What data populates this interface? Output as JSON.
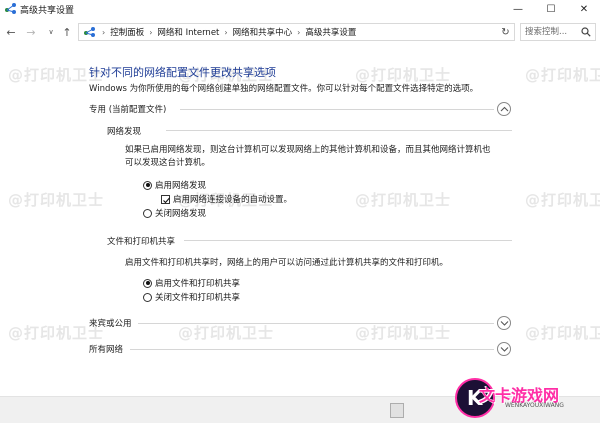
{
  "window": {
    "title": "高级共享设置",
    "minimize_glyph": "—",
    "maximize_glyph": "☐",
    "close_glyph": "✕"
  },
  "nav": {
    "back_glyph": "←",
    "forward_glyph": "→",
    "dropdown_glyph": "∨",
    "up_glyph": "↑",
    "refresh_glyph": "↻",
    "breadcrumbs": [
      "控制面板",
      "网络和 Internet",
      "网络和共享中心",
      "高级共享设置"
    ],
    "separator": "›",
    "search_placeholder": "搜索控制..."
  },
  "main": {
    "title": "针对不同的网络配置文件更改共享选项",
    "description": "Windows 为你所使用的每个网络创建单独的网络配置文件。你可以针对每个配置文件选择特定的选项。",
    "private_profile": {
      "label": "专用 (当前配置文件)",
      "expanded": true,
      "network_discovery": {
        "heading": "网络发现",
        "text_line1": "如果已启用网络发现，则这台计算机可以发现网络上的其他计算机和设备，而且其他网络计算机也",
        "text_line2": "可以发现这台计算机。",
        "option_on": "启用网络发现",
        "option_auto_setup": "启用网络连接设备的自动设置。",
        "option_off": "关闭网络发现",
        "selected": "on",
        "auto_setup_checked": true
      },
      "file_printer_sharing": {
        "heading": "文件和打印机共享",
        "text": "启用文件和打印机共享时，网络上的用户可以访问通过此计算机共享的文件和打印机。",
        "option_on": "启用文件和打印机共享",
        "option_off": "关闭文件和打印机共享",
        "selected": "on"
      }
    },
    "guest_public": {
      "label": "来宾或公用",
      "expanded": false
    },
    "all_networks": {
      "label": "所有网络",
      "expanded": false
    }
  },
  "watermark": {
    "text": "@打印机卫士"
  },
  "logo": {
    "main_text": "文卡游戏网",
    "mark": "K",
    "sub_text": "WENKAYOUXIWANG"
  },
  "colors": {
    "title_blue": "#1e3c96",
    "logo_pink": "#ff2ea6",
    "logo_dark": "#1c1035"
  }
}
